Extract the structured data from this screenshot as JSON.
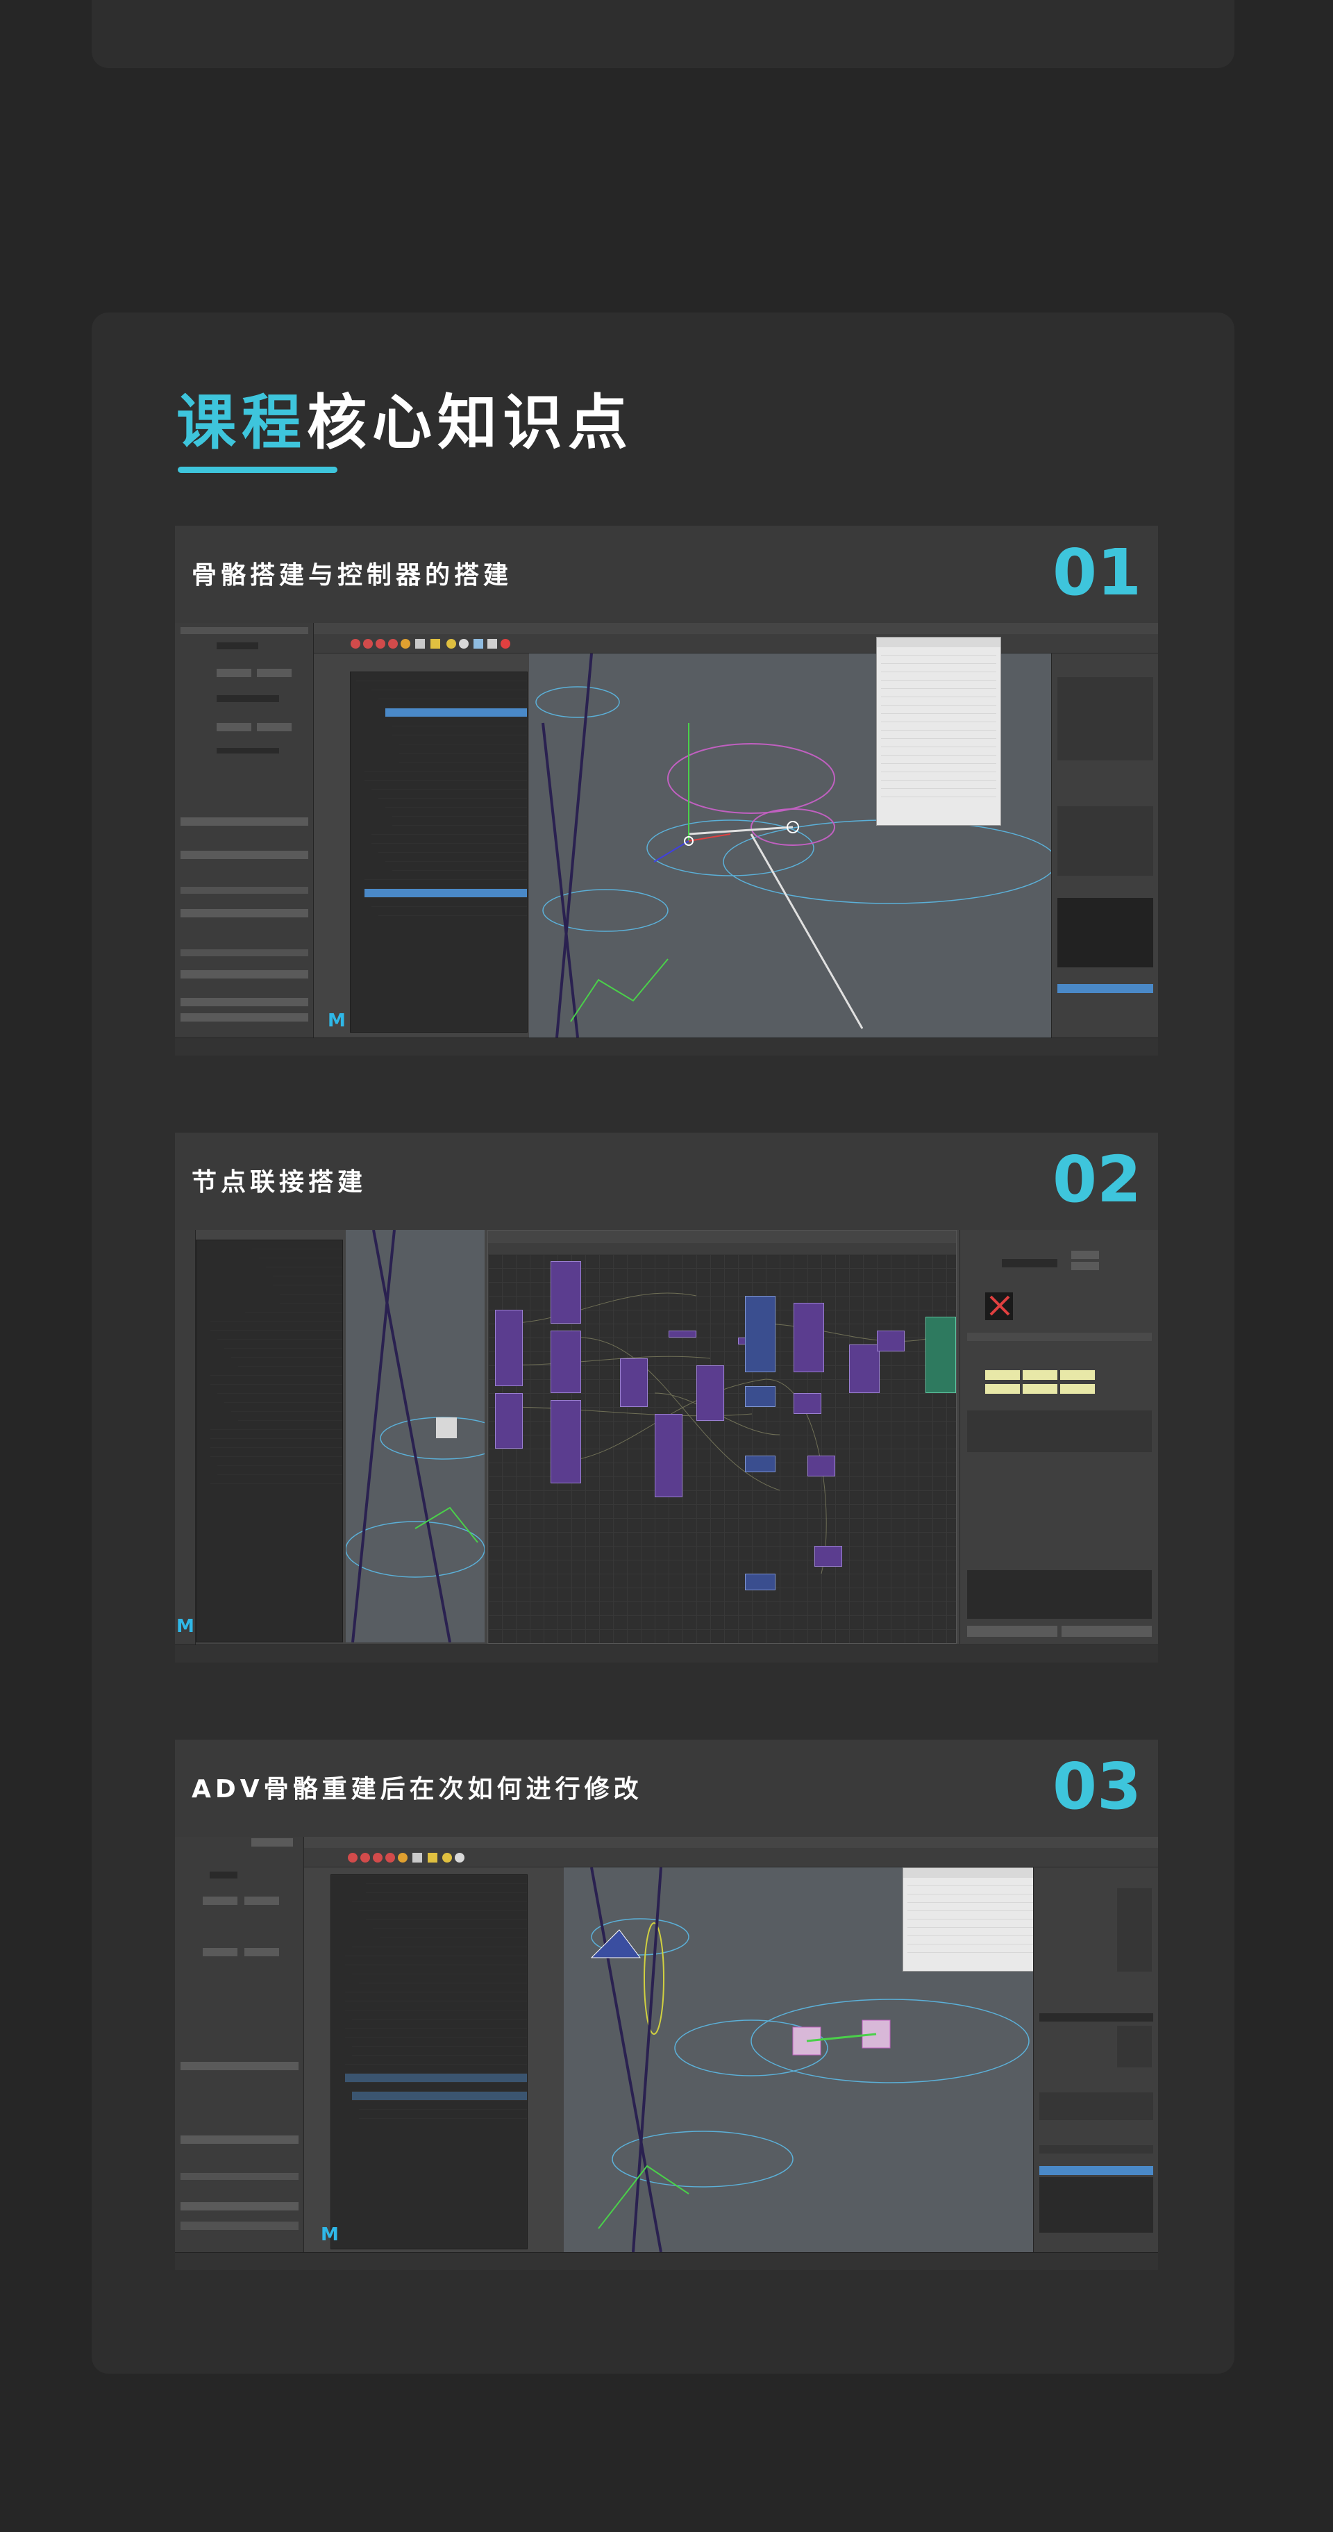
{
  "heading": {
    "accent": "课程",
    "rest": "核心知识点"
  },
  "sections": [
    {
      "title": "骨骼搭建与控制器的搭建",
      "number": "01"
    },
    {
      "title": "节点联接搭建",
      "number": "02"
    },
    {
      "title": "ADV骨骼重建后在次如何进行修改",
      "number": "03"
    }
  ],
  "colors": {
    "accent": "#3ec5dc",
    "background": "#262626",
    "card": "#2e2e2e",
    "node_purple": "#5b3d8f",
    "node_blue": "#3a4e8f"
  },
  "icons": [
    "maya-logo-icon"
  ]
}
